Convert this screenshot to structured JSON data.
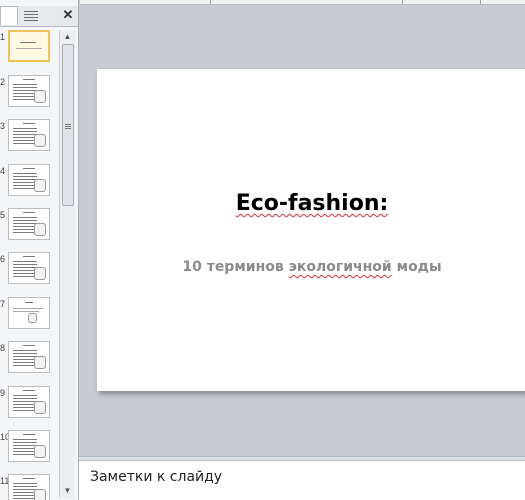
{
  "slides_panel": {
    "tab_label": "",
    "thumbnails": [
      {
        "number": "1"
      },
      {
        "number": "2"
      },
      {
        "number": "3"
      },
      {
        "number": "4"
      },
      {
        "number": "5"
      },
      {
        "number": "6"
      },
      {
        "number": "7"
      },
      {
        "number": "8"
      },
      {
        "number": "9"
      },
      {
        "number": "10"
      },
      {
        "number": "11"
      }
    ],
    "selected_index": 0
  },
  "slide": {
    "title": "Eco-fashion:",
    "subtitle_part1": "10 терминов ",
    "subtitle_part2": "экологичной",
    "subtitle_part3": " моды"
  },
  "notes": {
    "placeholder": "Заметки к слайду"
  },
  "colors": {
    "selected_thumb_border": "#f0c35a",
    "subtitle": "#8a8a8a",
    "spellcheck": "#e03030"
  }
}
